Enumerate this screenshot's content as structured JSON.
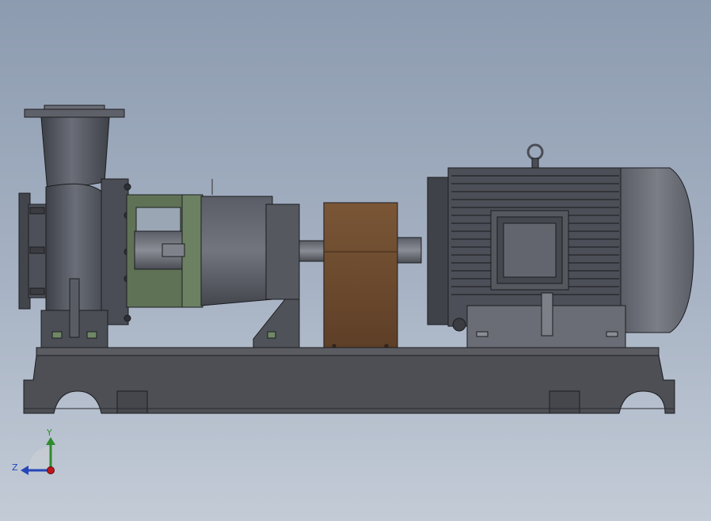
{
  "viewport": {
    "background_top": "#8d9bb0",
    "background_bottom": "#c3cbd6"
  },
  "colors": {
    "casing": "#4a4d55",
    "casing_light": "#6a6e78",
    "bracket_green": "#5f7256",
    "coupling_guard": "#6b4a30",
    "motor": "#4c4f57",
    "motor_cap": "#6f727a",
    "base": "#505257",
    "outline": "#1c1d20"
  },
  "triad": {
    "x_label": "",
    "y_label": "Y",
    "z_label": "Z",
    "y_color": "#2e8b2e",
    "z_color": "#2646b8",
    "origin_color": "#c0151a"
  }
}
